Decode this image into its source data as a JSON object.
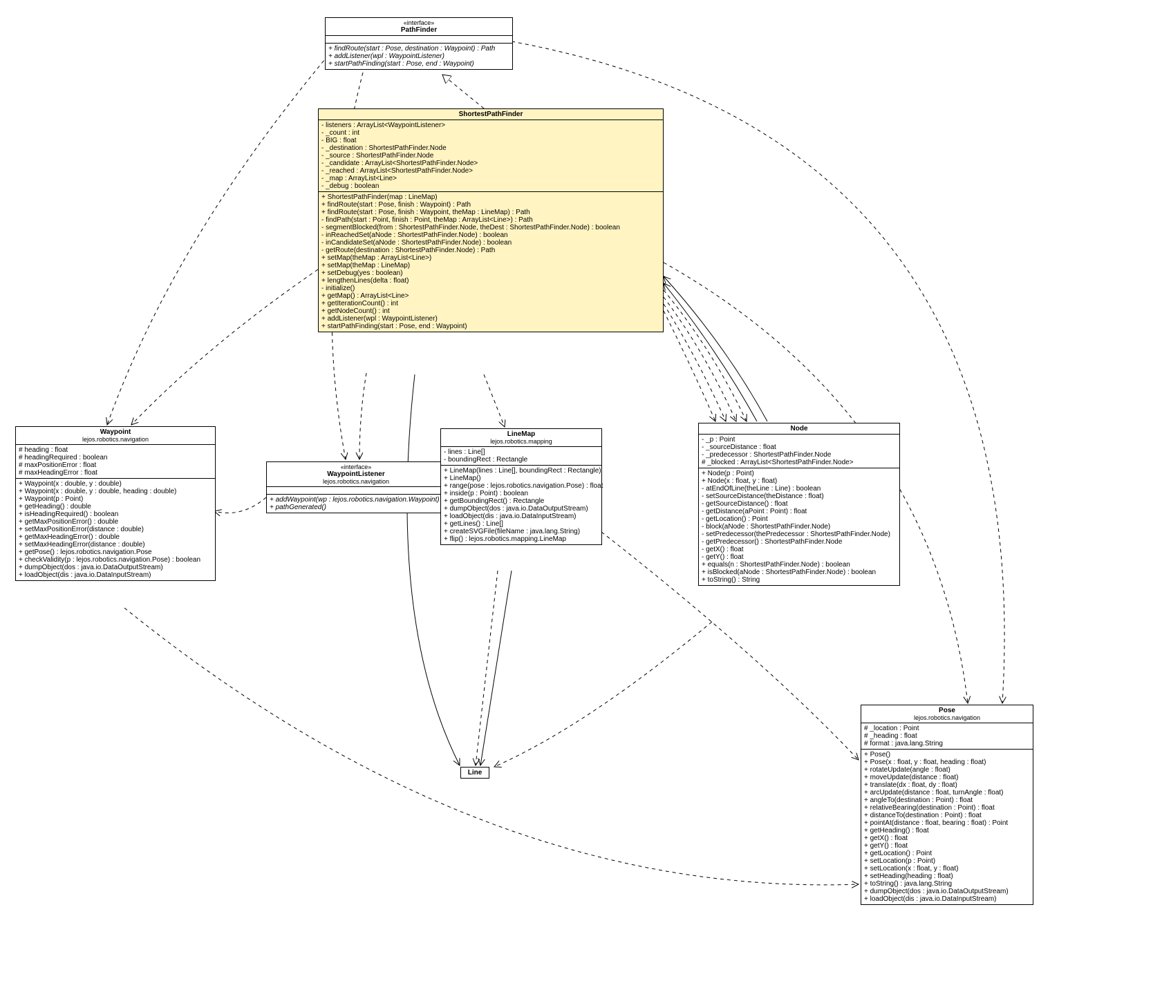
{
  "classes": {
    "pathfinder": {
      "stereotype": "«interface»",
      "name": "PathFinder",
      "members": [
        "+ findRoute(start : Pose, destination : Waypoint) : Path",
        "+ addListener(wpl : WaypointListener)",
        "+ startPathFinding(start : Pose, end : Waypoint)"
      ]
    },
    "shortestpathfinder": {
      "name": "ShortestPathFinder",
      "attributes": [
        "- listeners : ArrayList<WaypointListener>",
        "- _count : int",
        "- BIG : float",
        "- _destination : ShortestPathFinder.Node",
        "- _source : ShortestPathFinder.Node",
        "- _candidate : ArrayList<ShortestPathFinder.Node>",
        "- _reached : ArrayList<ShortestPathFinder.Node>",
        "- _map : ArrayList<Line>",
        "- _debug : boolean"
      ],
      "methods": [
        "+ ShortestPathFinder(map : LineMap)",
        "+ findRoute(start : Pose, finish : Waypoint) : Path",
        "+ findRoute(start : Pose, finish : Waypoint, theMap : LineMap) : Path",
        "- findPath(start : Point, finish : Point, theMap : ArrayList<Line>) : Path",
        "- segmentBlocked(from : ShortestPathFinder.Node, theDest : ShortestPathFinder.Node) : boolean",
        "- inReachedSet(aNode : ShortestPathFinder.Node) : boolean",
        "- inCandidateSet(aNode : ShortestPathFinder.Node) : boolean",
        "- getRoute(destination : ShortestPathFinder.Node) : Path",
        "+ setMap(theMap : ArrayList<Line>)",
        "+ setMap(theMap : LineMap)",
        "+ setDebug(yes : boolean)",
        "+ lengthenLines(delta : float)",
        "- initialize()",
        "+ getMap() : ArrayList<Line>",
        "+ getIterationCount() : int",
        "+ getNodeCount() : int",
        "+ addListener(wpl : WaypointListener)",
        "+ startPathFinding(start : Pose, end : Waypoint)"
      ]
    },
    "waypoint": {
      "name": "Waypoint",
      "package": "lejos.robotics.navigation",
      "attributes": [
        "# heading : float",
        "# headingRequired : boolean",
        "# maxPositionError : float",
        "# maxHeadingError : float"
      ],
      "methods": [
        "+ Waypoint(x : double, y : double)",
        "+ Waypoint(x : double, y : double, heading : double)",
        "+ Waypoint(p : Point)",
        "+ getHeading() : double",
        "+ isHeadingRequired() : boolean",
        "+ getMaxPositionError() : double",
        "+ setMaxPositionError(distance : double)",
        "+ getMaxHeadingError() : double",
        "+ setMaxHeadingError(distance : double)",
        "+ getPose() : lejos.robotics.navigation.Pose",
        "+ checkValidity(p : lejos.robotics.navigation.Pose) : boolean",
        "+ dumpObject(dos : java.io.DataOutputStream)",
        "+ loadObject(dis : java.io.DataInputStream)"
      ]
    },
    "waypointlistener": {
      "stereotype": "«interface»",
      "name": "WaypointListener",
      "package": "lejos.robotics.navigation",
      "members": [
        "+ addWaypoint(wp : lejos.robotics.navigation.Waypoint)",
        "+ pathGenerated()"
      ]
    },
    "linemap": {
      "name": "LineMap",
      "package": "lejos.robotics.mapping",
      "attributes": [
        "- lines : Line[]",
        "- boundingRect : Rectangle"
      ],
      "methods": [
        "+ LineMap(lines : Line[], boundingRect : Rectangle)",
        "+ LineMap()",
        "+ range(pose : lejos.robotics.navigation.Pose) : float",
        "+ inside(p : Point) : boolean",
        "+ getBoundingRect() : Rectangle",
        "+ dumpObject(dos : java.io.DataOutputStream)",
        "+ loadObject(dis : java.io.DataInputStream)",
        "+ getLines() : Line[]",
        "+ createSVGFile(fileName : java.lang.String)",
        "+ flip() : lejos.robotics.mapping.LineMap"
      ]
    },
    "node": {
      "name": "Node",
      "attributes": [
        "- _p : Point",
        "- _sourceDistance : float",
        "- _predecessor : ShortestPathFinder.Node",
        "# _blocked : ArrayList<ShortestPathFinder.Node>"
      ],
      "methods": [
        "+ Node(p : Point)",
        "+ Node(x : float, y : float)",
        "- atEndOfLine(theLine : Line) : boolean",
        "- setSourceDistance(theDistance : float)",
        "- getSourceDistance() : float",
        "- getDistance(aPoint : Point) : float",
        "- getLocation() : Point",
        "- block(aNode : ShortestPathFinder.Node)",
        "- setPredecessor(thePredecessor : ShortestPathFinder.Node)",
        "- getPredecessor() : ShortestPathFinder.Node",
        "- getX() : float",
        "- getY() : float",
        "+ equals(n : ShortestPathFinder.Node) : boolean",
        "+ isBlocked(aNode : ShortestPathFinder.Node) : boolean",
        "+ toString() : String"
      ]
    },
    "pose": {
      "name": "Pose",
      "package": "lejos.robotics.navigation",
      "attributes": [
        "# _location : Point",
        "# _heading : float",
        "# format : java.lang.String"
      ],
      "methods": [
        "+ Pose()",
        "+ Pose(x : float, y : float, heading : float)",
        "+ rotateUpdate(angle : float)",
        "+ moveUpdate(distance : float)",
        "+ translate(dx : float, dy : float)",
        "+ arcUpdate(distance : float, turnAngle : float)",
        "+ angleTo(destination : Point) : float",
        "+ relativeBearing(destination : Point) : float",
        "+ distanceTo(destination : Point) : float",
        "+ pointAt(distance : float, bearing : float) : Point",
        "+ getHeading() : float",
        "+ getX() : float",
        "+ getY() : float",
        "+ getLocation() : Point",
        "+ setLocation(p : Point)",
        "+ setLocation(x : float, y : float)",
        "+ setHeading(heading : float)",
        "+ toString() : java.lang.String",
        "+ dumpObject(dos : java.io.DataOutputStream)",
        "+ loadObject(dis : java.io.DataInputStream)"
      ]
    },
    "line": {
      "name": "Line"
    }
  }
}
